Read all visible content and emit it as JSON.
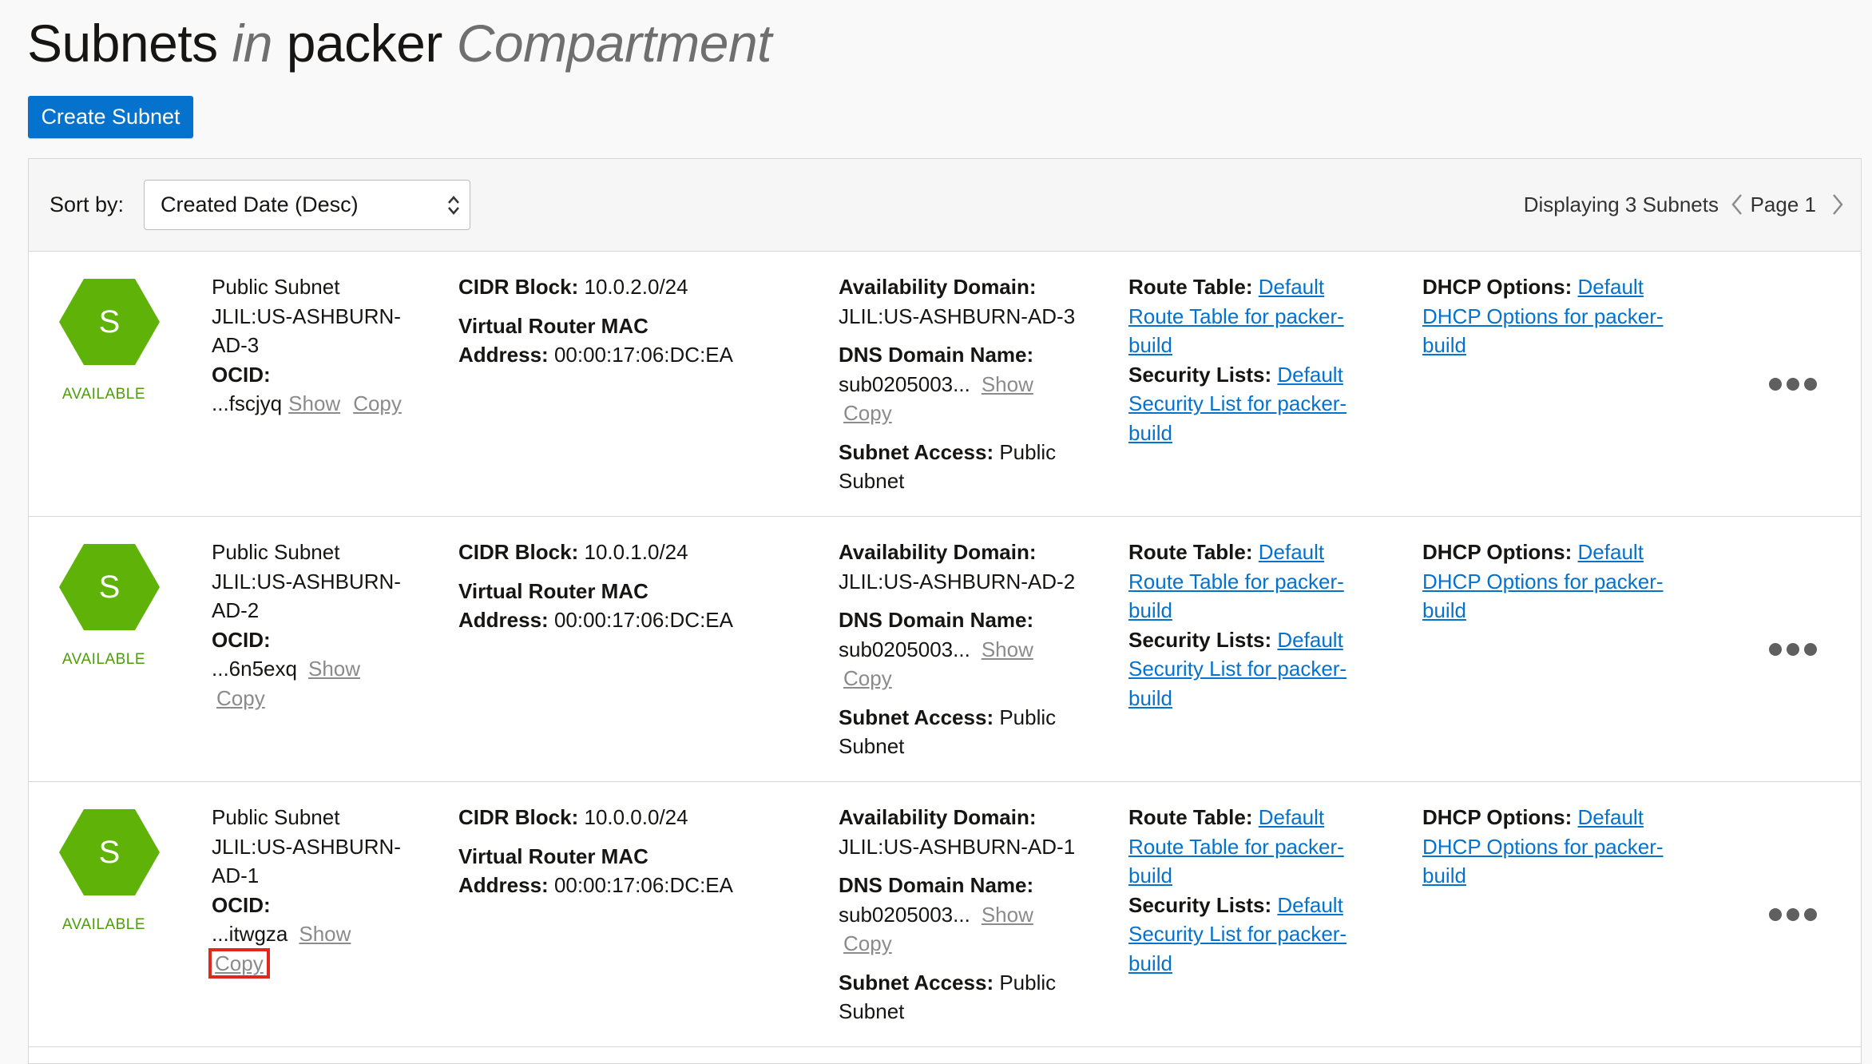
{
  "header": {
    "title_part1": "Subnets",
    "title_in": "in",
    "title_compartment": "packer",
    "title_suffix": "Compartment",
    "create_button": "Create Subnet"
  },
  "toolbar": {
    "sort_label": "Sort by:",
    "sort_value": "Created Date (Desc)",
    "displaying": "Displaying 3 Subnets",
    "page": "Page 1"
  },
  "labels": {
    "ocid": "OCID:",
    "cidr": "CIDR Block:",
    "vr_mac_1": "Virtual Router MAC",
    "vr_mac_2": "Address:",
    "ad": "Availability Domain:",
    "dns": "DNS Domain Name:",
    "subnet_access": "Subnet Access:",
    "route_table": "Route Table:",
    "security_lists": "Security Lists:",
    "dhcp": "DHCP Options:",
    "show": "Show",
    "copy": "Copy"
  },
  "colors": {
    "status_green": "#5fb308",
    "primary_blue": "#0572ce",
    "highlight_red": "#e0281f"
  },
  "subnets": [
    {
      "icon_letter": "S",
      "status": "AVAILABLE",
      "name_1": "Public Subnet",
      "name_2": "JLIL:US-ASHBURN-",
      "name_3": "AD-3",
      "ocid_short": "...fscjyq",
      "cidr": "10.0.2.0/24",
      "mac": "00:00:17:06:DC:EA",
      "ad": "JLIL:US-ASHBURN-AD-3",
      "dns": "sub0205003...",
      "access_1": "Public",
      "access_2": "Subnet",
      "route_1": "Default",
      "route_2": "Route Table for packer-",
      "route_3": "build",
      "sec_1": "Default",
      "sec_2": "Security List for packer-",
      "sec_3": "build",
      "dhcp_1": "Default",
      "dhcp_2": "DHCP Options for packer-",
      "dhcp_3": "build"
    },
    {
      "icon_letter": "S",
      "status": "AVAILABLE",
      "name_1": "Public Subnet",
      "name_2": "JLIL:US-ASHBURN-",
      "name_3": "AD-2",
      "ocid_short": "...6n5exq",
      "cidr": "10.0.1.0/24",
      "mac": "00:00:17:06:DC:EA",
      "ad": "JLIL:US-ASHBURN-AD-2",
      "dns": "sub0205003...",
      "access_1": "Public",
      "access_2": "Subnet",
      "route_1": "Default",
      "route_2": "Route Table for packer-",
      "route_3": "build",
      "sec_1": "Default",
      "sec_2": "Security List for packer-",
      "sec_3": "build",
      "dhcp_1": "Default",
      "dhcp_2": "DHCP Options for packer-",
      "dhcp_3": "build"
    },
    {
      "icon_letter": "S",
      "status": "AVAILABLE",
      "name_1": "Public Subnet",
      "name_2": "JLIL:US-ASHBURN-",
      "name_3": "AD-1",
      "ocid_short": "...itwgza",
      "cidr": "10.0.0.0/24",
      "mac": "00:00:17:06:DC:EA",
      "ad": "JLIL:US-ASHBURN-AD-1",
      "dns": "sub0205003...",
      "access_1": "Public",
      "access_2": "Subnet",
      "route_1": "Default",
      "route_2": "Route Table for packer-",
      "route_3": "build",
      "sec_1": "Default",
      "sec_2": "Security List for packer-",
      "sec_3": "build",
      "dhcp_1": "Default",
      "dhcp_2": "DHCP Options for packer-",
      "dhcp_3": "build"
    }
  ]
}
